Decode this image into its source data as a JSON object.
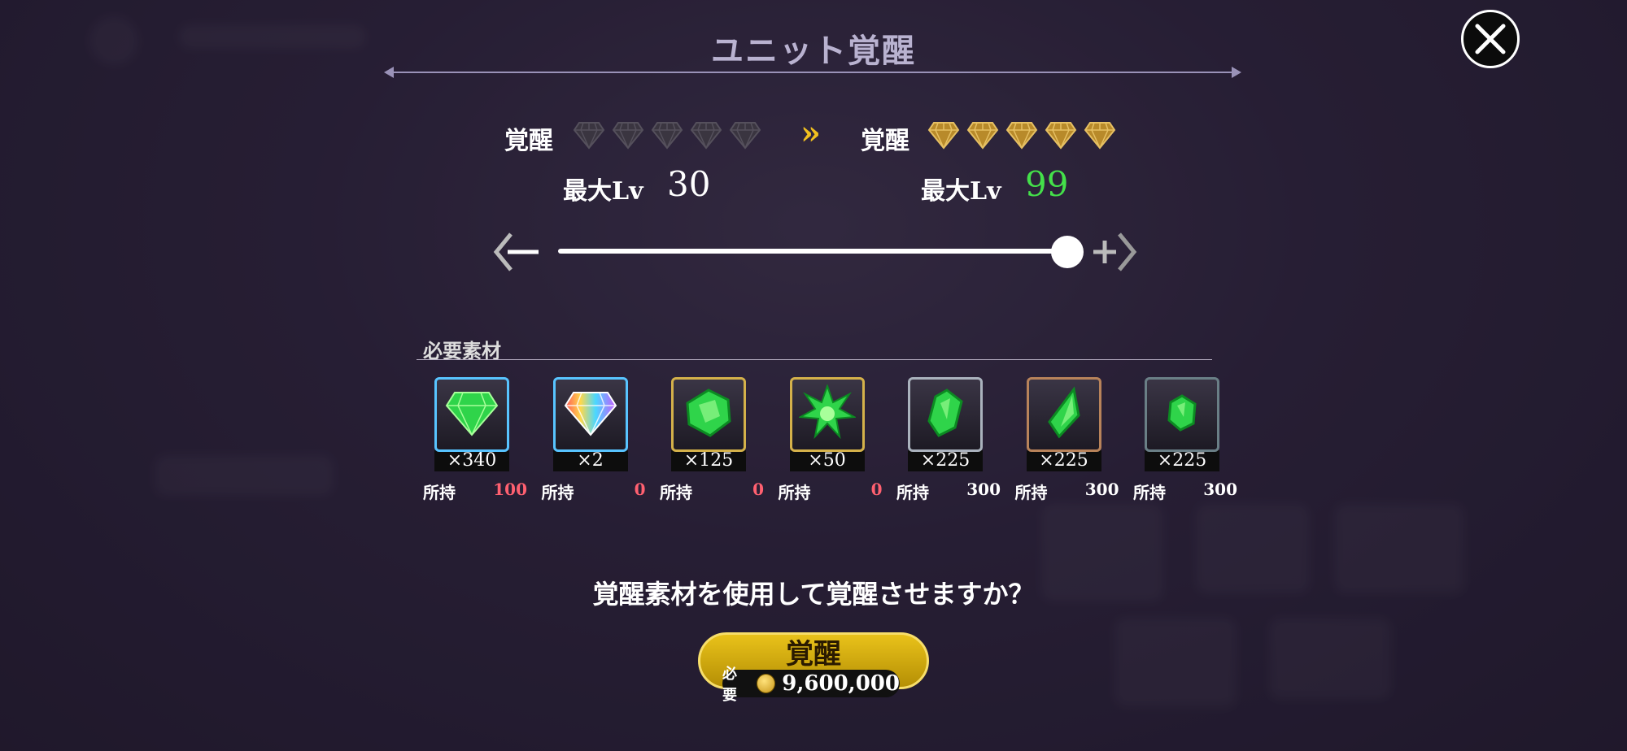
{
  "title": "ユニット覚醒",
  "current": {
    "label": "覚醒",
    "gems_filled": 0,
    "gems_total": 5,
    "max_lv_label": "最大Lv",
    "max_lv": "30"
  },
  "next": {
    "label": "覚醒",
    "gems_filled": 5,
    "gems_total": 5,
    "max_lv_label": "最大Lv",
    "max_lv": "99"
  },
  "slider": {
    "value": 1.0
  },
  "materials_label": "必要素材",
  "materials": [
    {
      "icon": "green-diamond-icon",
      "count": "×340",
      "owned_label": "所持",
      "owned": "100",
      "owned_color": "#ff6070",
      "frame": "#58c4ff"
    },
    {
      "icon": "rainbow-diamond-icon",
      "count": "×2",
      "owned_label": "所持",
      "owned": "0",
      "owned_color": "#ff6070",
      "frame": "#58c4ff"
    },
    {
      "icon": "green-crystal-icon",
      "count": "×125",
      "owned_label": "所持",
      "owned": "0",
      "owned_color": "#ff6070",
      "frame": "#d4b14a"
    },
    {
      "icon": "green-star-crystal-icon",
      "count": "×50",
      "owned_label": "所持",
      "owned": "0",
      "owned_color": "#ff6070",
      "frame": "#d4b14a"
    },
    {
      "icon": "green-shard-icon",
      "count": "×225",
      "owned_label": "所持",
      "owned": "300",
      "owned_color": "#ffffff",
      "frame": "#aab2bd"
    },
    {
      "icon": "green-spike-icon",
      "count": "×225",
      "owned_label": "所持",
      "owned": "300",
      "owned_color": "#ffffff",
      "frame": "#b8835a"
    },
    {
      "icon": "green-pebble-icon",
      "count": "×225",
      "owned_label": "所持",
      "owned": "300",
      "owned_color": "#ffffff",
      "frame": "#6a7f86"
    }
  ],
  "question": "覚醒素材を使用して覚醒させますか？",
  "action": {
    "button_label": "覚醒",
    "need_label": "必要",
    "cost": "9,600,000"
  },
  "colors": {
    "accent_gold": "#e9c21a",
    "next_lv": "#44e04a",
    "chevron": "#f0c020"
  }
}
